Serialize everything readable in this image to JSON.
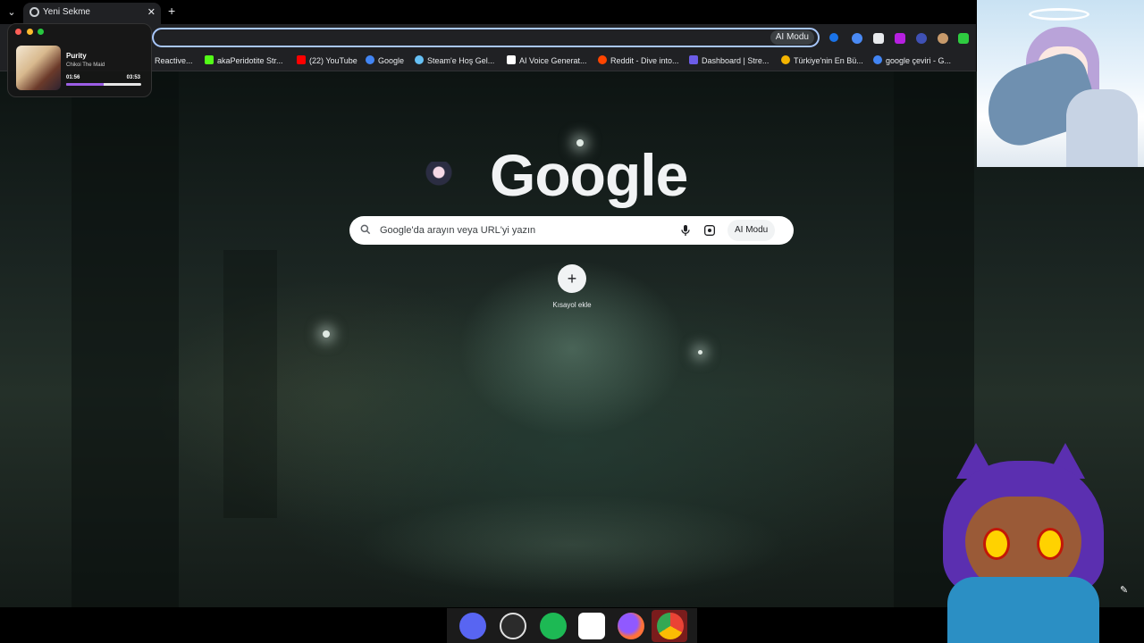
{
  "browser": {
    "tab": {
      "title": "Yeni Sekme"
    },
    "omnibox": {
      "ai_mode_label": "AI Modu"
    },
    "bookmarks": [
      {
        "label": "Reactive...",
        "color": "#4caf50"
      },
      {
        "label": "akaPeridotite Str...",
        "color": "#53fc18"
      },
      {
        "label": "(22) YouTube",
        "color": "#ff0000"
      },
      {
        "label": "Google",
        "color": "#4285f4"
      },
      {
        "label": "Steam'e Hoş Gel...",
        "color": "#1b2838"
      },
      {
        "label": "AI Voice Generat...",
        "color": "#ffffff"
      },
      {
        "label": "Reddit - Dive into...",
        "color": "#ff4500"
      },
      {
        "label": "Dashboard | Stre...",
        "color": "#6c5ce7"
      },
      {
        "label": "Türkiye'nin En Bü...",
        "color": "#f4b400"
      },
      {
        "label": "google çeviri - G...",
        "color": "#4285f4"
      }
    ]
  },
  "music": {
    "title": "Purity",
    "artist": "Chikoi The Maid",
    "current_time": "01:56",
    "duration": "03:53",
    "progress": 0.5,
    "accent": "#9b5de5"
  },
  "newtab": {
    "logo": "Google",
    "search_placeholder": "Google'da arayın veya URL'yi yazın",
    "ai_mode_label": "AI Modu",
    "shortcut_label": "Kısayol ekle"
  },
  "dock": {
    "apps": [
      "discord-icon",
      "obs-icon",
      "spotify-icon",
      "vrchat-icon",
      "firefox-icon",
      "chrome-icon"
    ]
  }
}
